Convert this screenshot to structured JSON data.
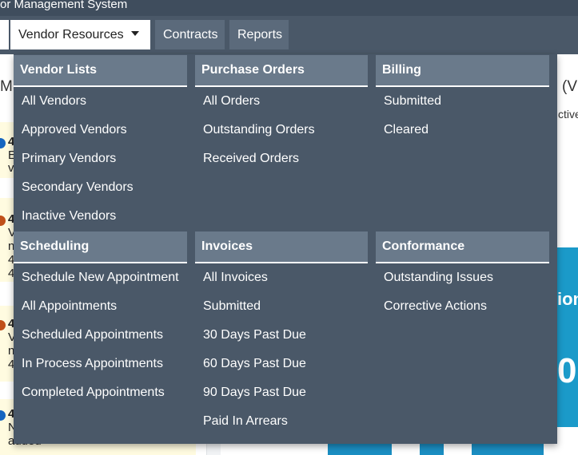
{
  "app": {
    "title": "or Management System"
  },
  "nav": {
    "items": [
      {
        "label": "Vendor Resources",
        "active": true
      },
      {
        "label": "Contracts"
      },
      {
        "label": "Reports"
      }
    ]
  },
  "background": {
    "heading_left": "MS",
    "heading_right": "(V",
    "right_fragment": "ctivel",
    "cards": [
      {
        "number": "4",
        "lines": [
          "E",
          "v"
        ],
        "dot_color": "#1565c0"
      },
      {
        "number": "4",
        "lines": [
          "V",
          "n",
          "4",
          "4"
        ],
        "dot_color": "#c0501a"
      },
      {
        "number": "4",
        "lines": [
          "V",
          "n",
          "4"
        ],
        "dot_color": "#c0501a"
      },
      {
        "number": "4",
        "lines": [
          "N",
          "added"
        ],
        "dot_color": "#1565c0"
      }
    ],
    "banner_text": "ion",
    "banner_number": "0"
  },
  "menu": {
    "sections": [
      {
        "heading": "Vendor Lists",
        "links": [
          "All Vendors",
          "Approved Vendors",
          "Primary Vendors",
          "Secondary Vendors",
          "Inactive Vendors"
        ]
      },
      {
        "heading": "Purchase Orders",
        "links": [
          "All Orders",
          "Outstanding Orders",
          "Received Orders"
        ]
      },
      {
        "heading": "Billing",
        "links": [
          "Submitted",
          "Cleared"
        ]
      },
      {
        "heading": "Scheduling",
        "links": [
          "Schedule New Appointment",
          "All Appointments",
          "Scheduled Appointments",
          "In Process Appointments",
          "Completed Appointments"
        ]
      },
      {
        "heading": "Invoices",
        "links": [
          "All Invoices",
          "Submitted",
          "30 Days Past Due",
          "60 Days Past Due",
          "90 Days Past Due",
          "Paid In Arrears"
        ]
      },
      {
        "heading": "Conformance",
        "links": [
          "Outstanding Issues",
          "Corrective Actions"
        ]
      }
    ]
  },
  "colors": {
    "title_bar": "#3f4d5d",
    "nav_bar": "#4a5868",
    "menu_bg": "#4a5868",
    "menu_heading_bg": "#6a7a8b",
    "banner_blue": "#1b9ac9",
    "card_bg": "#fffbe0"
  }
}
